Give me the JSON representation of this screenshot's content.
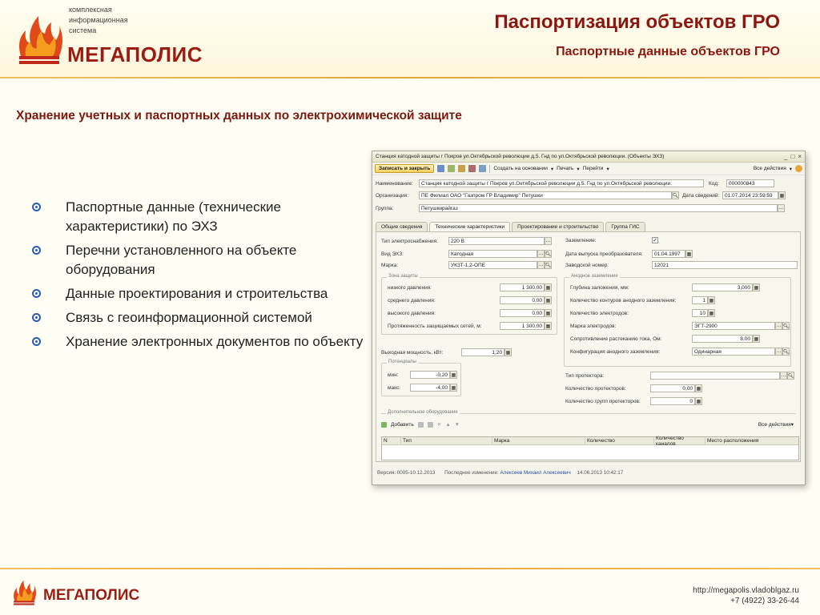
{
  "logo": {
    "line1": "комплексная",
    "line2": "информационная",
    "line3": "система",
    "name": "МЕГАПОЛИС"
  },
  "header": {
    "title": "Паспортизация объектов ГРО",
    "subtitle": "Паспортные данные объектов ГРО"
  },
  "heading": "Хранение учетных и паспортных данных по электрохимической защите",
  "bullets": [
    "Паспортные данные (технические характеристики) по ЭХЗ",
    "Перечни установленного на объекте оборудования",
    "Данные проектирования и строительства",
    "Связь с геоинформационной системой",
    "Хранение электронных документов по объекту"
  ],
  "footer": {
    "name": "МЕГАПОЛИС",
    "url": "http://megapolis.vladoblgaz.ru",
    "phone": "+7 (4922) 33-26-44"
  },
  "win": {
    "title": "Станция катодной защиты г Покров ул.Октябрьской революции д.5. Гнд по ул.Октябрьской революции. (Объекты ЭХЗ)",
    "controls": [
      "_",
      "□",
      "×"
    ],
    "toolbar": {
      "save_close": "Записать и закрыть",
      "create_based": "Создать на основании",
      "print": "Печать",
      "goto": "Перейти",
      "all_actions": "Все действия"
    },
    "name_label": "Наименование:",
    "name_value": "Станция катодной защиты г Покров ул.Октябрьской революции д.5. Гнд по ул.Октябрьской революции.",
    "code_label": "Код:",
    "code_value": "000000843",
    "org_label": "Организация:",
    "org_value": "ПЕ Филиал ОАО \"Газпром ГР Владимир\" Петушки",
    "date_label": "Дата сведений:",
    "date_value": "01.07.2014 23:59:59",
    "group_label": "Группа:",
    "group_value": "Петушкирайгаз",
    "tabs": [
      "Общие сведения",
      "Технические характеристики",
      "Проектирование и строительство",
      "Группа ГИС"
    ],
    "power_type_label": "Тип электроснабжения:",
    "power_type_value": "220 В",
    "grounding_label": "Заземление:",
    "grounding_check": "✓",
    "ecp_type_label": "Вид ЭХЗ:",
    "ecp_type_value": "Катодная",
    "release_date_label": "Дата выпуска преобразователя:",
    "release_date_value": "01.04.1997",
    "brand_label": "Марка:",
    "brand_value": "УКЗТ-1,2-ОПЕ",
    "serial_label": "Заводской номер:",
    "serial_value": "12021",
    "zone_group": "Зона защиты",
    "low_label": "низкого давления:",
    "low_value": "1 300,00",
    "mid_label": "среднего давления:",
    "mid_value": "0,00",
    "high_label": "высокого давления:",
    "high_value": "0,00",
    "length_label": "Протяженность защищаемых сетей, м:",
    "length_value": "1 300,00",
    "anode_group": "Анодное заземление",
    "depth_label": "Глубина заложения, мм:",
    "depth_value": "3,000",
    "circuits_label": "Количество контуров анодного заземления:",
    "circuits_value": "1",
    "electrodes_count_label": "Количество электродов:",
    "electrodes_count_value": "10",
    "electrode_brand_label": "Марка электродов:",
    "electrode_brand_value": "ЭГТ-2900",
    "resistance_label": "Сопротивление растеканию тока, Ом:",
    "resistance_value": "8,00",
    "anode_config_label": "Конфигурация анодного заземления:",
    "anode_config_value": "Одинарная",
    "out_power_label": "Выходная мощность, кВт:",
    "out_power_value": "1,20",
    "potentials_group": "Потенциалы",
    "min_label": "мин:",
    "min_value": "-0,20",
    "max_label": "макс:",
    "max_value": "-4,00",
    "protector_type_label": "Тип протектора:",
    "protector_count_label": "Количество протекторов:",
    "protector_count_value": "0,00",
    "protector_groups_label": "Количество групп протекторов:",
    "protector_groups_value": "0",
    "extra_group": "Дополнительное оборудование",
    "add_label": "Добавить",
    "all_actions2": "Все действия",
    "columns": [
      "N",
      "Тип",
      "Марка",
      "Количество",
      "Количество каналов",
      "Место расположения"
    ],
    "version": "Версия: 0005-10.12.2013",
    "last_change_label": "Последнее изменение:",
    "last_change_value": "Алексеев Михаил Алексеевич",
    "last_change_date": "14.06.2013 10:42:17"
  }
}
